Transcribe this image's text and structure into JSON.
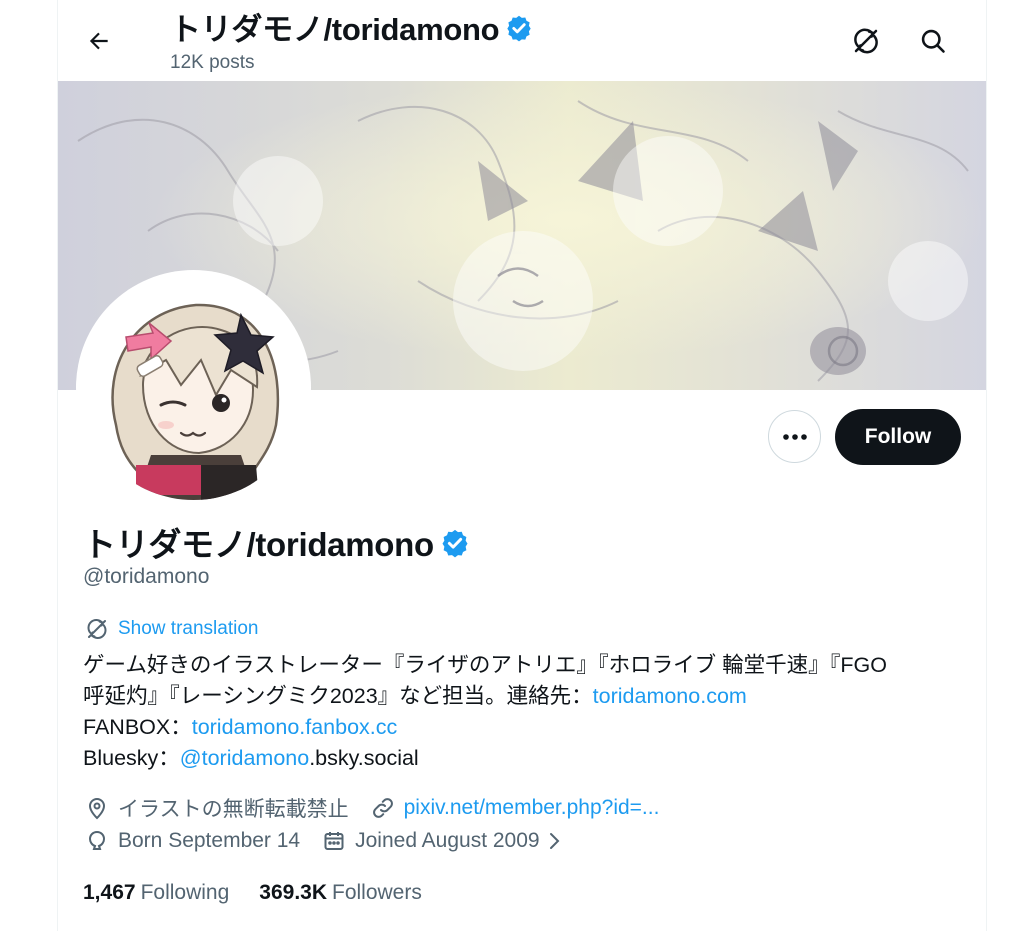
{
  "header": {
    "title": "トリダモノ/toridamono",
    "post_count": "12K posts"
  },
  "profile": {
    "display_name": "トリダモノ/toridamono",
    "handle": "@toridamono",
    "show_translation": "Show translation",
    "bio": {
      "line1": "ゲーム好きのイラストレーター『ライザのアトリエ』『ホロライブ 輪堂千速』『FGO",
      "line2_text": "呼延灼』『レーシングミク2023』など担当。連絡先：",
      "line2_link": "toridamono.com",
      "line3_text": "FANBOX：",
      "line3_link": "toridamono.fanbox.cc",
      "line4_text": "Bluesky：",
      "line4_link": "@toridamono",
      "line4_rest": ".bsky.social"
    },
    "location": "イラストの無断転載禁止",
    "website": "pixiv.net/member.php?id=...",
    "birthday": "Born September 14",
    "joined": "Joined August 2009",
    "following_count": "1,467",
    "following_label": "Following",
    "followers_count": "369.3K",
    "followers_label": "Followers"
  },
  "actions": {
    "follow_label": "Follow"
  },
  "colors": {
    "accent": "#1d9bf0",
    "text_primary": "#0f1419",
    "text_secondary": "#536471",
    "follow_bg": "#0f1419",
    "border": "#cfd9de"
  },
  "icons": [
    "back-arrow-icon",
    "verified-badge-icon",
    "translate-icon",
    "search-icon",
    "more-icon",
    "location-icon",
    "link-icon",
    "birthday-icon",
    "calendar-icon",
    "chevron-right-icon"
  ]
}
